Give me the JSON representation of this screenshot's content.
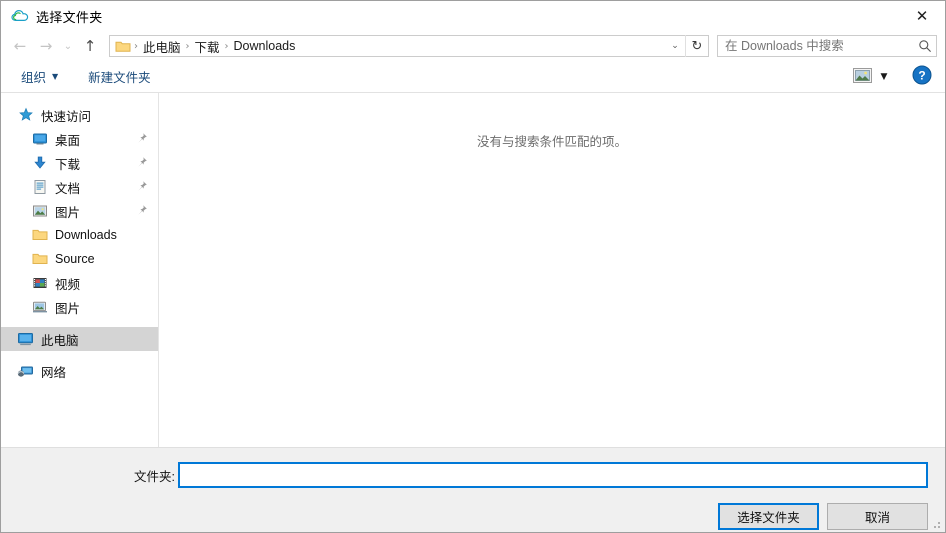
{
  "window": {
    "title": "选择文件夹",
    "title_icon": "cloud-icon",
    "close_label": "✕"
  },
  "navbar": {
    "back": "←",
    "forward": "→",
    "recent": "⌄",
    "up": "↑",
    "address_dropdown": "⌄",
    "refresh": "↻",
    "breadcrumbs": [
      {
        "label": "此电脑"
      },
      {
        "label": "下载"
      },
      {
        "label": "Downloads"
      }
    ],
    "separator": "›"
  },
  "search": {
    "placeholder": "在 Downloads 中搜索",
    "value": ""
  },
  "toolbar": {
    "organize_label": "组织",
    "organize_caret": "▼",
    "new_folder_label": "新建文件夹",
    "view_caret": "▼",
    "help_label": "?"
  },
  "sidebar": {
    "items": [
      {
        "label": "快速访问",
        "icon": "star-icon",
        "indent": false,
        "pinned": false,
        "selected": false
      },
      {
        "label": "桌面",
        "icon": "desktop-icon",
        "indent": true,
        "pinned": true,
        "selected": false
      },
      {
        "label": "下载",
        "icon": "download-icon",
        "indent": true,
        "pinned": true,
        "selected": false
      },
      {
        "label": "文档",
        "icon": "document-icon",
        "indent": true,
        "pinned": true,
        "selected": false
      },
      {
        "label": "图片",
        "icon": "pictures-icon",
        "indent": true,
        "pinned": true,
        "selected": false
      },
      {
        "label": "Downloads",
        "icon": "folder-icon",
        "indent": true,
        "pinned": false,
        "selected": false
      },
      {
        "label": "Source",
        "icon": "folder-icon",
        "indent": true,
        "pinned": false,
        "selected": false
      },
      {
        "label": "视频",
        "icon": "video-icon",
        "indent": true,
        "pinned": false,
        "selected": false
      },
      {
        "label": "图片",
        "icon": "photo-monitor-icon",
        "indent": true,
        "pinned": false,
        "selected": false
      },
      {
        "label": "此电脑",
        "icon": "this-pc-icon",
        "indent": false,
        "pinned": false,
        "selected": true
      },
      {
        "label": "网络",
        "icon": "network-icon",
        "indent": false,
        "pinned": false,
        "selected": false
      }
    ]
  },
  "filelist": {
    "empty_message": "没有与搜索条件匹配的项。"
  },
  "footer": {
    "folder_label": "文件夹:",
    "folder_value": "",
    "select_button": "选择文件夹",
    "cancel_button": "取消"
  },
  "colors": {
    "accent": "#0078d7",
    "selection": "#d4d4d4",
    "footer_bg": "#f0f0f0",
    "toolbar_link": "#1a4a7a",
    "folder_yellow": "#fcd77f"
  }
}
